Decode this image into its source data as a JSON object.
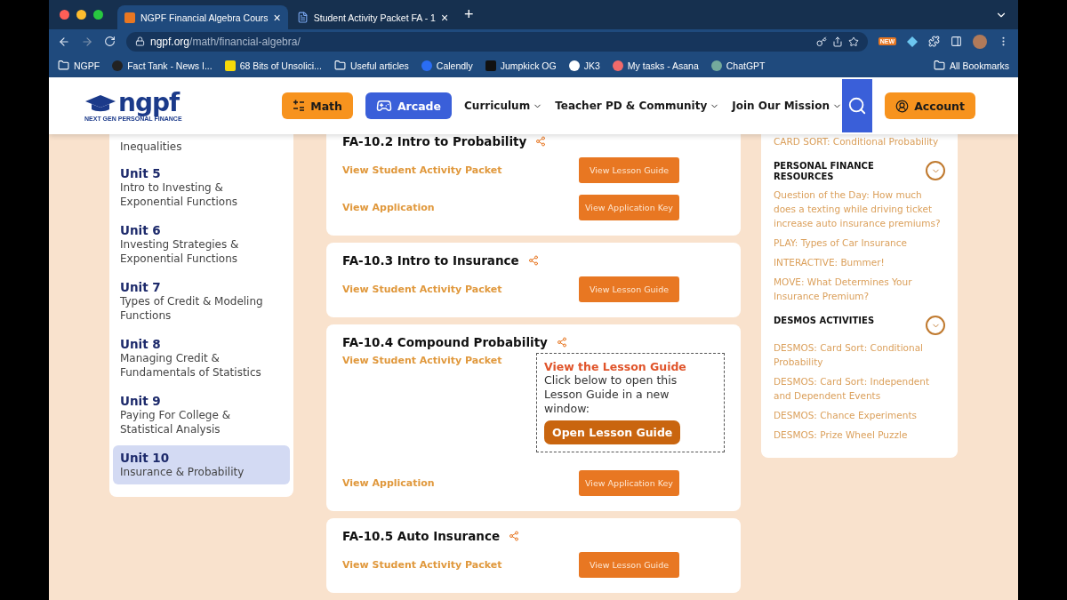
{
  "browser": {
    "tabs": [
      {
        "title": "NGPF Financial Algebra Cours",
        "close": "×",
        "selected": true,
        "kind": "site"
      },
      {
        "title": "Student Activity Packet FA - 1",
        "close": "×",
        "selected": false,
        "kind": "doc"
      }
    ],
    "new_tab": "+",
    "address": {
      "host": "ngpf.org",
      "path": "/math/financial-algebra/"
    },
    "extension_badge": "NEW",
    "bookmarks": [
      {
        "label": "NGPF",
        "kind": "folder"
      },
      {
        "label": "Fact Tank - News I...",
        "kind": "dark"
      },
      {
        "label": "68 Bits of Unsolici...",
        "kind": "kk"
      },
      {
        "label": "Useful articles",
        "kind": "folder"
      },
      {
        "label": "Calendly",
        "kind": "calendly"
      },
      {
        "label": "Jumpkick OG",
        "kind": "jk"
      },
      {
        "label": "JK3",
        "kind": "jk3"
      },
      {
        "label": "My tasks - Asana",
        "kind": "asana"
      },
      {
        "label": "ChatGPT",
        "kind": "chatgpt"
      }
    ],
    "all_bookmarks": "All Bookmarks"
  },
  "header": {
    "logo": "ngpf",
    "tagline": "NEXT GEN PERSONAL FINANCE",
    "nav": [
      {
        "label": "Math",
        "kind": "math"
      },
      {
        "label": "Arcade",
        "kind": "arcade"
      },
      {
        "label": "Curriculum",
        "kind": "menu"
      },
      {
        "label": "Teacher PD & Community",
        "kind": "menu"
      },
      {
        "label": "Join Our Mission",
        "kind": "menu"
      }
    ],
    "account": "Account"
  },
  "units": [
    {
      "title": "Inequalities",
      "selected": false
    },
    {
      "unit": "Unit 5",
      "title": "Intro to Investing & Exponential Functions",
      "selected": false
    },
    {
      "unit": "Unit 6",
      "title": "Investing Strategies & Exponential Functions",
      "selected": false
    },
    {
      "unit": "Unit 7",
      "title": "Types of Credit & Modeling Functions",
      "selected": false
    },
    {
      "unit": "Unit 8",
      "title": "Managing Credit & Fundamentals of Statistics",
      "selected": false
    },
    {
      "unit": "Unit 9",
      "title": "Paying For College & Statistical Analysis",
      "selected": false
    },
    {
      "unit": "Unit 10",
      "title": "Insurance & Probability",
      "selected": true
    }
  ],
  "lessons": [
    {
      "title": "FA-10.2 Intro to Probability",
      "rows": [
        {
          "link": "View Student Activity Packet",
          "button": "View Lesson Guide"
        },
        {
          "link": "View Application",
          "button": "View Application Key"
        }
      ]
    },
    {
      "title": "FA-10.3 Intro to Insurance",
      "rows": [
        {
          "link": "View Student Activity Packet",
          "button": "View Lesson Guide"
        }
      ]
    },
    {
      "title": "FA-10.4 Compound Probability",
      "rows": [
        {
          "link": "View Student Activity Packet",
          "popup": {
            "heading": "View the Lesson Guide",
            "text": "Click below to open this Lesson Guide in a new window:",
            "button": "Open Lesson Guide"
          }
        },
        {
          "link": "View Application",
          "button": "View Application Key"
        }
      ]
    },
    {
      "title": "FA-10.5 Auto Insurance",
      "rows": [
        {
          "link": "View Student Activity Packet",
          "button": "View Lesson Guide"
        }
      ]
    }
  ],
  "resources": [
    {
      "links": [
        "CARD SORT: Conditional Probability"
      ]
    },
    {
      "heading": "PERSONAL FINANCE RESOURCES",
      "links": [
        "Question of the Day: How much does a texting while driving ticket increase auto insurance premiums?",
        "PLAY: Types of Car Insurance",
        "INTERACTIVE: Bummer!",
        "MOVE: What Determines Your Insurance Premium?"
      ]
    },
    {
      "heading": "DESMOS ACTIVITIES",
      "links": [
        "DESMOS: Card Sort: Conditional Probability",
        "DESMOS: Card Sort: Independent and Dependent Events",
        "DESMOS: Chance Experiments",
        "DESMOS: Prize Wheel Puzzle"
      ]
    }
  ]
}
